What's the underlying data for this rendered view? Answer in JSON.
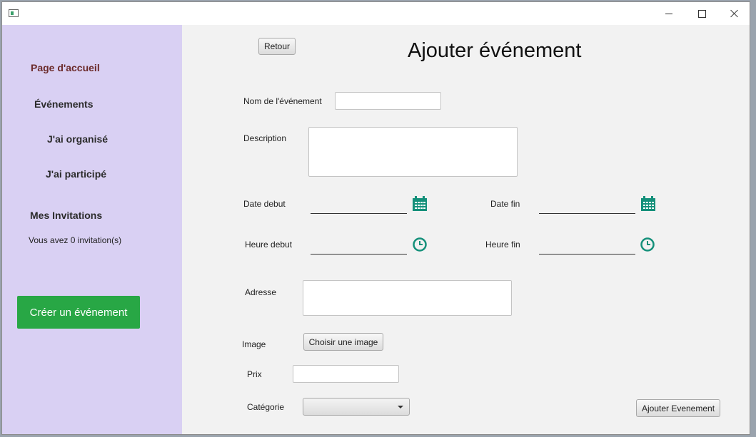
{
  "sidebar": {
    "home": "Page d'accueil",
    "events": "Événements",
    "organized": "J'ai organisé",
    "participated": "J'ai participé",
    "invitations": "Mes Invitations",
    "invitation_count": "Vous avez 0 invitation(s)",
    "create_button": "Créer un événement",
    "home_color": "#6b2a2a",
    "create_color": "#28a745",
    "background": "#d9d0f3"
  },
  "form": {
    "back_button": "Retour",
    "title": "Ajouter événement",
    "name_label": "Nom de l'événement",
    "name_value": "",
    "description_label": "Description",
    "description_value": "",
    "start_date_label": "Date debut",
    "end_date_label": "Date fin",
    "start_time_label": "Heure debut",
    "end_time_label": "Heure fin",
    "address_label": "Adresse",
    "address_value": "",
    "image_label": "Image",
    "image_button": "Choisir une image",
    "price_label": "Prix",
    "price_value": "",
    "category_label": "Catégorie",
    "category_selected": "",
    "submit_button": "Ajouter Evenement",
    "icon_color": "#14907a"
  },
  "icons": {
    "calendar": "calendar-icon",
    "clock": "clock-icon"
  }
}
